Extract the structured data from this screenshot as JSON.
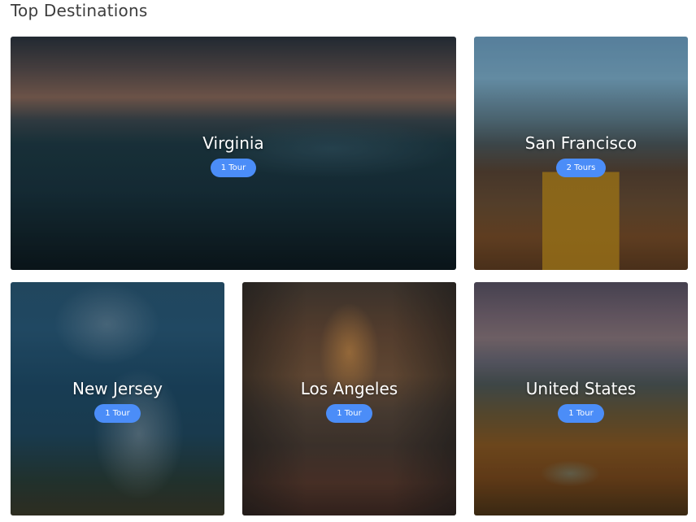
{
  "section": {
    "title": "Top Destinations"
  },
  "destinations": [
    {
      "name": "Virginia",
      "tours": "1 Tour"
    },
    {
      "name": "San Francisco",
      "tours": "2 Tours"
    },
    {
      "name": "New Jersey",
      "tours": "1 Tour"
    },
    {
      "name": "Los Angeles",
      "tours": "1 Tour"
    },
    {
      "name": "United States",
      "tours": "1 Tour"
    }
  ],
  "colors": {
    "badge_bg": "#4b8df8",
    "heading_text": "#3d3d3d",
    "card_text": "#ffffff"
  }
}
